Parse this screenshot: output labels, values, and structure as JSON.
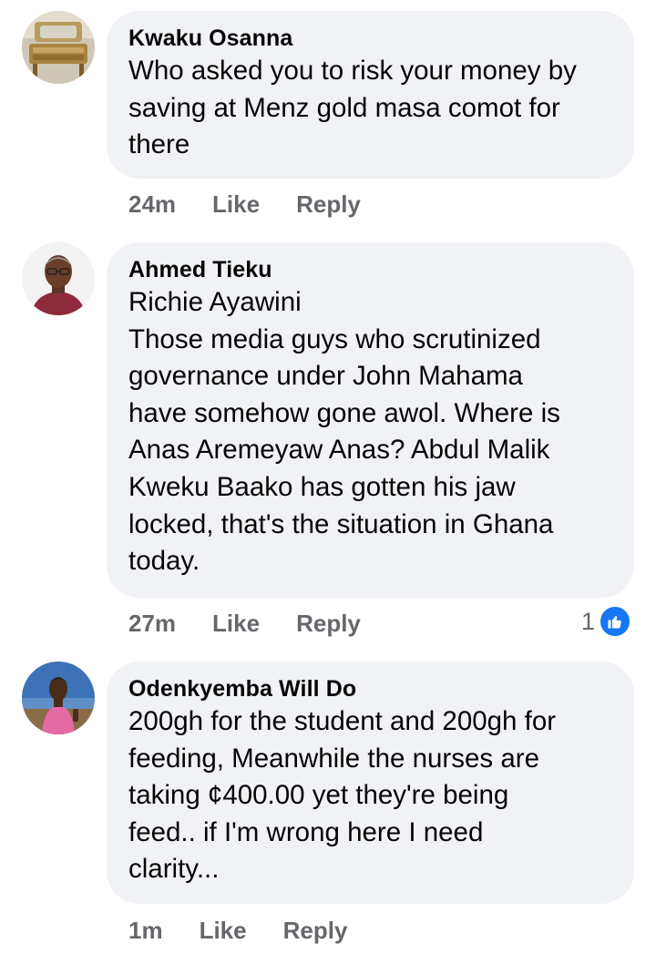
{
  "comments": [
    {
      "author": "Kwaku Osanna",
      "lines": [
        "Who asked you to risk your money by",
        "saving at Menz gold masa comot for",
        "there"
      ],
      "time": "24m",
      "like_label": "Like",
      "reply_label": "Reply",
      "avatar_icon": "avatar-photo-furniture"
    },
    {
      "author": "Ahmed Tieku",
      "lines": [
        "Richie Ayawini",
        "Those media guys who scrutinized",
        "governance under John Mahama",
        "have somehow gone awol. Where is",
        "Anas Aremeyaw Anas? Abdul Malik",
        "Kweku Baako has gotten his jaw",
        "locked, that's the situation in Ghana",
        "today."
      ],
      "time": "27m",
      "like_label": "Like",
      "reply_label": "Reply",
      "reaction_count": "1",
      "reaction_icon": "like-reaction-icon",
      "avatar_icon": "avatar-photo-man-glasses"
    },
    {
      "author": "Odenkyemba Will Do",
      "lines": [
        "200gh for the student and 200gh for",
        "feeding, Meanwhile the nurses are",
        "taking ¢400.00 yet they're being",
        "feed.. if I'm wrong here I need",
        "clarity..."
      ],
      "time": "1m",
      "like_label": "Like",
      "reply_label": "Reply",
      "avatar_icon": "avatar-photo-man-pink-shirt"
    }
  ],
  "colors": {
    "bubble": "#f0f2f5",
    "meta_text": "#65676b",
    "like_blue": "#1877f2"
  }
}
